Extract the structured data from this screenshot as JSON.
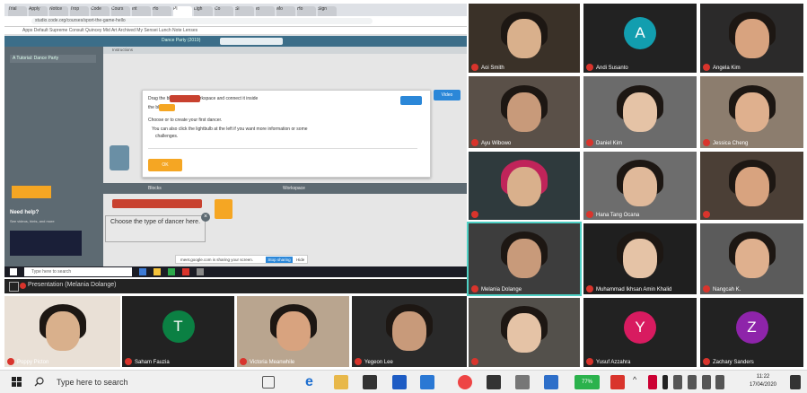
{
  "shared_screen": {
    "tabs": [
      "Trial",
      "Apply",
      "Notice",
      "Trop",
      "Code",
      "Cours",
      "Int",
      "Ho",
      "Pl",
      "Ligh",
      "Co",
      "Si",
      "fo",
      "Mo",
      "Ho",
      "Sign"
    ],
    "url": "studio.code.org/courses/sport-the-game-hello",
    "bookmarks": "Apps   Default   Supreme Consult   Quincey Mid   Art   Archived   My   Sensei   Lunch Note   Lenses",
    "app_title": "Dance Party (2019)",
    "left_selector": "A Tutorial: Dance Party",
    "lesson_label": "Instructions",
    "dialog_line1": "Drag the              block into the workspace and connect it inside",
    "dialog_line2": "the          block.",
    "dialog_line3": "Choose        or         to create your first dancer.",
    "dialog_line4": "You can also click the lightbulb at the left if you want more information or some",
    "dialog_line5": "challenges.",
    "ok_label": "OK",
    "hint_label": "Video",
    "blocks_label": "Blocks",
    "workspace_label": "Workspace",
    "need_help": "Need help?",
    "help_text": "See videos, hints, and more",
    "tooltip_text": "Choose the type of dancer here.",
    "tooltip_close": "×",
    "notif_text": "meet.google.com is sharing your screen.",
    "notif_stop": "Stop sharing",
    "notif_hide": "Hide",
    "inner_search": "Type here to search"
  },
  "presentation": {
    "label": "Presentation (Melania Dolange)"
  },
  "participants": [
    {
      "name": "Aoi Smith",
      "type": "video"
    },
    {
      "name": "Andi Susanto",
      "type": "avatar",
      "initial": "A",
      "color": "#129eaf"
    },
    {
      "name": "Angela Kim",
      "type": "video"
    },
    {
      "name": "Ayu Wibowo",
      "type": "video"
    },
    {
      "name": "Daniel Kim",
      "type": "video"
    },
    {
      "name": "Jessica Cheng",
      "type": "video"
    },
    {
      "name": "",
      "type": "video"
    },
    {
      "name": "Hana Tang Ocana",
      "type": "video"
    },
    {
      "name": "",
      "type": "video"
    },
    {
      "name": "Melania Dolange",
      "type": "video"
    },
    {
      "name": "Muhammad Ikhsan Amin Khalid",
      "type": "video"
    },
    {
      "name": "Nangcah K.",
      "type": "video"
    },
    {
      "name": "Poppy Picton",
      "type": "video"
    },
    {
      "name": "Saham Fauzia",
      "type": "avatar",
      "initial": "T",
      "color": "#0b8043"
    },
    {
      "name": "Victoria Meanwhile",
      "type": "video"
    },
    {
      "name": "Yegeon Lee",
      "type": "video"
    },
    {
      "name": "",
      "type": "video"
    },
    {
      "name": "Yusuf Azzahra",
      "type": "avatar",
      "initial": "Y",
      "color": "#d81b60"
    },
    {
      "name": "Zachary Sanders",
      "type": "avatar",
      "initial": "Z",
      "color": "#8e24aa"
    }
  ],
  "taskbar": {
    "search_placeholder": "Type here to search",
    "battery": "77%",
    "time": "11:22",
    "date": "17/04/2020"
  },
  "colors": {
    "accent_red": "#d9342c",
    "app_header": "#3c6e89",
    "taskbar": "#f0f0f0"
  }
}
